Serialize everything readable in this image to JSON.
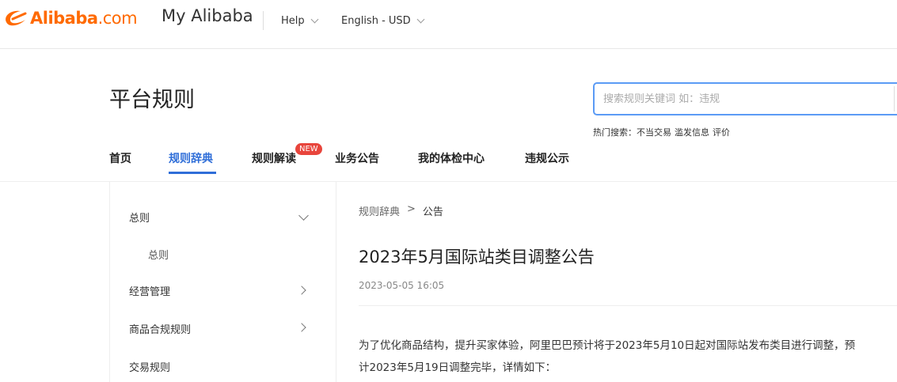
{
  "header": {
    "brand": "Alibaba",
    "brand_suffix": ".com",
    "site_name": "My Alibaba",
    "help_label": "Help",
    "lang_currency": "English - USD"
  },
  "page": {
    "title": "平台规则",
    "search_placeholder": "搜索规则关键词 如：违规",
    "hot_label": "热门搜索：",
    "hot_terms": [
      "不当交易",
      "滥发信息",
      "评价"
    ]
  },
  "nav": {
    "items": [
      "首页",
      "规则辞典",
      "规则解读",
      "业务公告",
      "我的体检中心",
      "违规公示"
    ],
    "active_index": 1,
    "new_badge": "NEW"
  },
  "sidebar": {
    "sections": [
      {
        "label": "总则",
        "expanded": true
      },
      {
        "label": "经营管理",
        "expanded": false
      },
      {
        "label": "商品合规规则",
        "expanded": false
      },
      {
        "label": "交易规则",
        "expanded": false
      }
    ],
    "sub_items": [
      "总则"
    ]
  },
  "breadcrumb": {
    "parent": "规则辞典",
    "separator": ">",
    "current": "公告"
  },
  "article": {
    "title": "2023年5月国际站类目调整公告",
    "date": "2023-05-05 16:05",
    "body_line1": "为了优化商品结构，提升买家体验，阿里巴巴预计将于2023年5月10日起对国际站发布类目进行调整，预",
    "body_line2": "计2023年5月19日调整完毕，详情如下："
  },
  "colors": {
    "brand_orange": "#ff6a00",
    "active_blue": "#2f6ed8",
    "search_border": "#5b9bf5",
    "badge_red": "#e8453c"
  }
}
